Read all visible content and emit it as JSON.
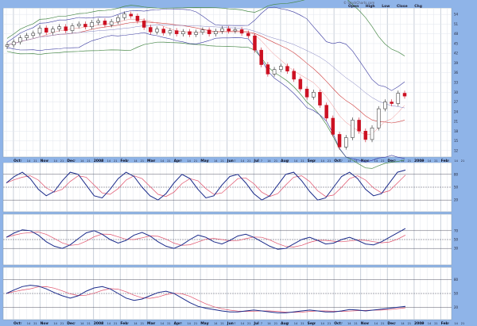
{
  "header": {
    "ohlc_labels": [
      "Open",
      "High",
      "Low",
      "Close",
      "Chg"
    ],
    "watermark": "© StockCharts.com"
  },
  "colors": {
    "candle_up": "#222222",
    "candle_down": "#cc1122",
    "osc_main": "#1a2a8a",
    "osc_signal": "#e0506a",
    "band_outer": "#4a8a4a",
    "band_inner": "#d04040",
    "axis_bg": "#8fb4e8",
    "plot_bg": "#ffffff"
  },
  "chart_data": [
    {
      "type": "candlestick",
      "panel": "price",
      "ylim": [
        10,
        56
      ],
      "grid": true,
      "overlays": [
        "bollinger-bands",
        "moving-averages"
      ],
      "close": [
        44.6,
        45.5,
        46.8,
        47.5,
        48.2,
        49.8,
        48.5,
        49.5,
        50.2,
        49,
        50.5,
        51,
        50.2,
        51.5,
        52,
        50.8,
        51.8,
        53,
        54.1,
        53.5,
        52,
        50,
        48.6,
        49.5,
        48.3,
        49,
        48,
        48.7,
        47.8,
        48.5,
        49.2,
        48,
        48.8,
        49.6,
        48.9,
        49.3,
        48.2,
        47.4,
        43,
        38.5,
        35.6,
        37,
        38,
        36.5,
        34,
        31,
        28.5,
        30,
        26,
        22,
        17,
        13.1,
        16,
        21.4,
        18,
        15.4,
        19,
        24.9,
        27,
        26.5,
        29.7,
        28.8
      ]
    },
    {
      "type": "line",
      "panel": "oscillator-1",
      "ylim": [
        0,
        100
      ],
      "levels": [
        20,
        50,
        80
      ],
      "values": [
        60,
        75,
        85,
        70,
        45,
        30,
        40,
        65,
        85,
        80,
        55,
        30,
        25,
        45,
        70,
        85,
        75,
        50,
        30,
        20,
        35,
        60,
        80,
        70,
        45,
        25,
        30,
        55,
        75,
        80,
        60,
        35,
        20,
        30,
        55,
        80,
        85,
        65,
        40,
        20,
        25,
        50,
        75,
        85,
        70,
        45,
        30,
        35,
        60,
        85,
        90
      ]
    },
    {
      "type": "line",
      "panel": "oscillator-2",
      "ylim": [
        0,
        100
      ],
      "levels": [
        30,
        50,
        70
      ],
      "values": [
        55,
        65,
        72,
        70,
        60,
        45,
        35,
        30,
        38,
        52,
        65,
        70,
        62,
        50,
        42,
        48,
        60,
        66,
        58,
        45,
        35,
        30,
        38,
        50,
        60,
        55,
        45,
        40,
        48,
        58,
        62,
        55,
        45,
        35,
        28,
        30,
        40,
        50,
        55,
        48,
        40,
        42,
        50,
        55,
        48,
        40,
        38,
        45,
        55,
        65,
        75
      ]
    },
    {
      "type": "line",
      "panel": "oscillator-3",
      "ylim": [
        0,
        100
      ],
      "levels": [
        20,
        50,
        80
      ],
      "values": [
        50,
        58,
        65,
        68,
        66,
        60,
        52,
        45,
        40,
        45,
        55,
        62,
        65,
        60,
        50,
        40,
        35,
        38,
        45,
        52,
        55,
        50,
        40,
        30,
        22,
        18,
        15,
        12,
        10,
        10,
        12,
        14,
        12,
        10,
        8,
        8,
        10,
        12,
        14,
        12,
        10,
        10,
        12,
        15,
        14,
        12,
        14,
        16,
        18,
        20,
        22
      ]
    }
  ],
  "x_axis": {
    "months": [
      "Oct",
      "Nov",
      "Dec",
      "2008",
      "Feb",
      "Mar",
      "Apr",
      "May",
      "Jun",
      "Jul",
      "Aug",
      "Sep",
      "Oct",
      "Nov",
      "Dec",
      "2009",
      "Feb"
    ]
  }
}
